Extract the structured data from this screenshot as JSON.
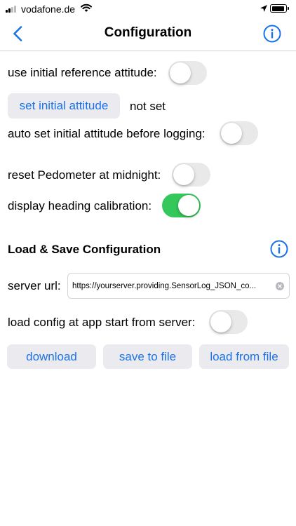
{
  "status_bar": {
    "carrier": "vodafone.de"
  },
  "nav": {
    "title": "Configuration"
  },
  "settings": {
    "use_initial_reference": {
      "label": "use initial reference attitude:",
      "on": false
    },
    "set_initial_attitude_button": "set initial attitude",
    "initial_attitude_status": "not set",
    "auto_set_initial": {
      "label": "auto set initial attitude before logging:",
      "on": false
    },
    "reset_pedometer": {
      "label": "reset Pedometer at midnight:",
      "on": false
    },
    "display_heading_calibration": {
      "label": "display heading calibration:",
      "on": true
    }
  },
  "load_save": {
    "title": "Load & Save Configuration",
    "server_url_label": "server url:",
    "server_url_value": "https://yourserver.providing.SensorLog_JSON_co...",
    "load_at_start": {
      "label": "load config at app start from server:",
      "on": false
    },
    "buttons": {
      "download": "download",
      "save_to_file": "save to file",
      "load_from_file": "load from file"
    }
  },
  "colors": {
    "accent": "#1a73e8",
    "toggle_on": "#34c759",
    "toggle_off": "#e9e9ea",
    "button_bg": "#ebebef"
  }
}
